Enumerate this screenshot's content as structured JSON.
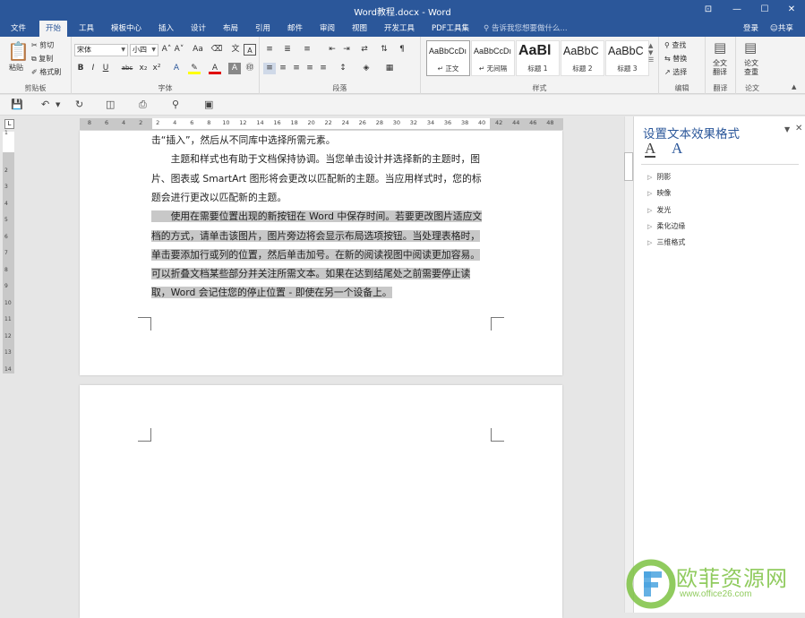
{
  "app": {
    "title": "Word教程.docx - Word",
    "window_buttons": [
      "⊡",
      "—",
      "☐",
      "✕"
    ]
  },
  "tabs": [
    "文件",
    "开始",
    "工具",
    "模板中心",
    "插入",
    "设计",
    "布局",
    "引用",
    "邮件",
    "审阅",
    "视图",
    "开发工具",
    "PDF工具集"
  ],
  "active_tab": "开始",
  "tell_me": "告诉我您想要做什么...",
  "account": {
    "signin": "登录",
    "share": "共享"
  },
  "clipboard": {
    "paste": "粘贴",
    "cut": "剪切",
    "copy": "复制",
    "format_painter": "格式刷",
    "label": "剪贴板"
  },
  "font": {
    "name": "宋体",
    "size": "小四",
    "label": "字体",
    "grow": "A˄",
    "shrink": "A˅",
    "case": "Aa",
    "bold": "B",
    "italic": "I",
    "underline": "U",
    "strike": "abc",
    "sub": "x₂",
    "sup": "x²"
  },
  "paragraph": {
    "label": "段落"
  },
  "styles": {
    "label": "样式",
    "items": [
      {
        "sample": "AaBbCcDı",
        "name": "↵ 正文"
      },
      {
        "sample": "AaBbCcDı",
        "name": "↵ 无间隔"
      },
      {
        "sample": "AaBl",
        "name": "标题 1"
      },
      {
        "sample": "AaBbC",
        "name": "标题 2"
      },
      {
        "sample": "AaBbC",
        "name": "标题 3"
      }
    ]
  },
  "editing": {
    "find": "查找",
    "replace": "替换",
    "select": "选择",
    "label": "编辑"
  },
  "translate": {
    "full_line1": "全文",
    "full_line2": "翻译",
    "label": "翻译"
  },
  "paper": {
    "check_line1": "论文",
    "check_line2": "查重",
    "label": "论文"
  },
  "ruler": {
    "h_labels": [
      "8",
      "6",
      "4",
      "2",
      "2",
      "4",
      "6",
      "8",
      "10",
      "12",
      "14",
      "16",
      "18",
      "20",
      "22",
      "24",
      "26",
      "28",
      "30",
      "32",
      "34",
      "36",
      "38",
      "40",
      "42",
      "44",
      "46",
      "48"
    ],
    "v_labels": [
      "1",
      "2",
      "3",
      "4",
      "5",
      "6",
      "7",
      "8",
      "9",
      "10",
      "11",
      "12",
      "13",
      "14"
    ]
  },
  "document": {
    "paragraphs": [
      {
        "lines": [
          "击“插入”，然后从不同库中选择所需元素。"
        ],
        "highlight": false
      },
      {
        "lines": [
          "　　主题和样式也有助于文档保持协调。当您单击设计并选择新的主题时，图",
          "片、图表或 SmartArt 图形将会更改以匹配新的主题。当应用样式时，您的标",
          "题会进行更改以匹配新的主题。"
        ],
        "highlight": false
      },
      {
        "lines": [
          "　　使用在需要位置出现的新按钮在 Word 中保存时间。若要更改图片适应文",
          "档的方式，请单击该图片，图片旁边将会显示布局选项按钮。当处理表格时，",
          "单击要添加行或列的位置，然后单击加号。在新的阅读视图中阅读更加容易。",
          "可以折叠文档某些部分并关注所需文本。如果在达到结尾处之前需要停止读",
          "取，Word 会记住您的停止位置 - 即使在另一个设备上。"
        ],
        "highlight": true
      }
    ]
  },
  "pane": {
    "title": "设置文本效果格式",
    "items": [
      "阴影",
      "映像",
      "发光",
      "柔化边缘",
      "三维格式"
    ]
  },
  "watermark": {
    "text": "欧菲资源网",
    "url": "www.office26.com"
  },
  "colors": {
    "accent": "#2b579a",
    "highlight": "#c8c8c8",
    "watermark": "#7dc242"
  }
}
